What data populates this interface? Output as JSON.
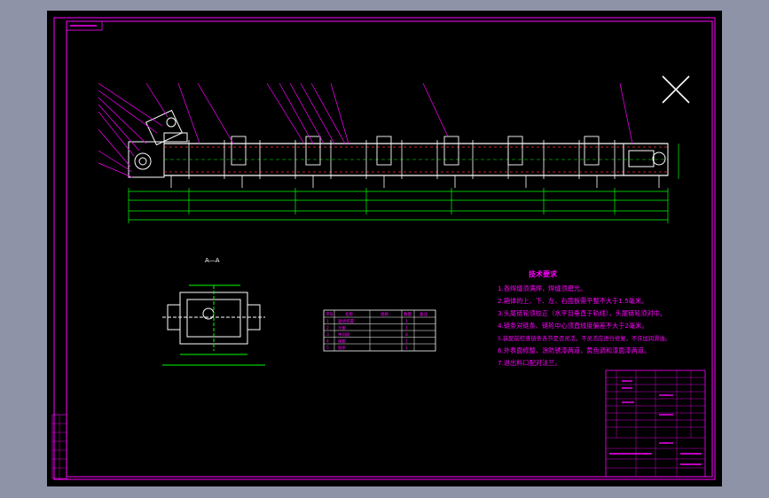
{
  "colors": {
    "background": "#8f93a7",
    "canvas": "#000000",
    "border": "#ff00ff",
    "geometry": "#ffffff",
    "dimension": "#00ff00",
    "accent": "#ff3030"
  },
  "icons": [
    "close-x-icon"
  ],
  "drawing": {
    "section_label": "A—A",
    "tech_requirements": {
      "title": "技术要求",
      "lines": [
        "1.各焊缝须满焊，焊缝须磨光。",
        "2.箱体的上、下、左、右面板需平整不大于1.5毫米。",
        "3.头尾链轮须校正（水平且垂直于轨线），头尾链轮须对中。",
        "4.链条对链条、链轮中心须直线度偏差不大于2毫米。",
        "5.装配前检查链条各节是否灵活，不灵活应进行修复，不许加润滑油。",
        "6.外表面修整，涂防锈漆两道，黄色调和漆面漆两道。",
        "7.进出料口配对法兰。"
      ]
    },
    "parts_table": {
      "header": [
        "序号",
        "名称",
        "规格",
        "数量",
        "备注"
      ],
      "rows": [
        [
          "1",
          "驱动装置",
          "",
          "1",
          ""
        ],
        [
          "2",
          "头部",
          "",
          "1",
          ""
        ],
        [
          "3",
          "中间段",
          "",
          "8",
          ""
        ],
        [
          "4",
          "尾部",
          "",
          "1",
          ""
        ],
        [
          "5",
          "链条",
          "",
          "1",
          ""
        ]
      ]
    }
  }
}
